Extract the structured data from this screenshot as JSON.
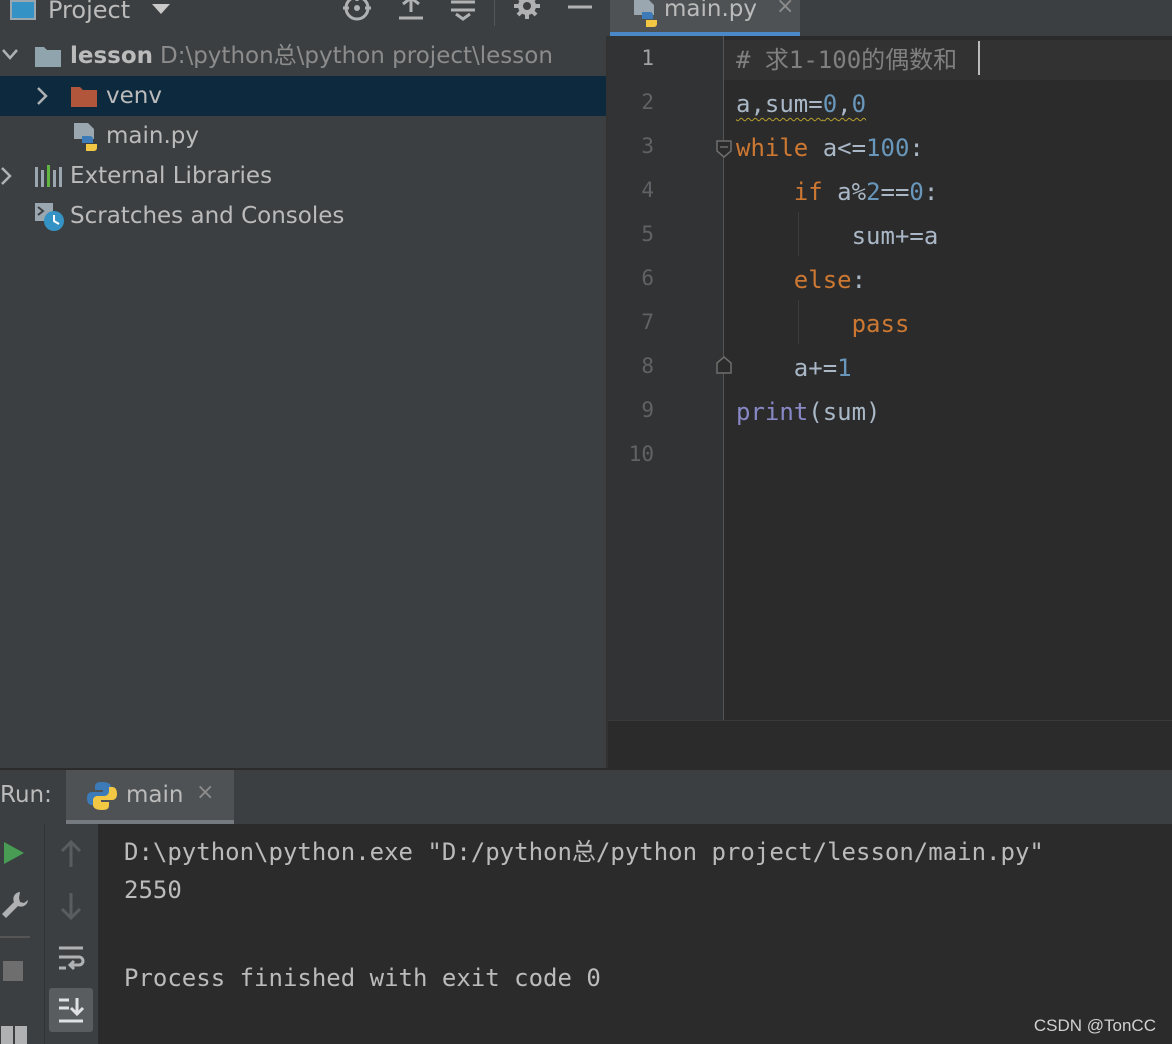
{
  "project_panel": {
    "title": "Project",
    "tree": [
      {
        "label": "lesson",
        "path": "D:\\python总\\python project\\lesson",
        "icon": "folder-icon",
        "expanded": true
      },
      {
        "label": "venv",
        "icon": "excluded-folder-icon",
        "selected": true
      },
      {
        "label": "main.py",
        "icon": "python-file-icon"
      },
      {
        "label": "External Libraries",
        "icon": "libraries-icon"
      },
      {
        "label": "Scratches and Consoles",
        "icon": "scratches-icon"
      }
    ]
  },
  "editor": {
    "tab": {
      "label": "main.py",
      "close": "×"
    },
    "line_numbers": [
      "1",
      "2",
      "3",
      "4",
      "5",
      "6",
      "7",
      "8",
      "9",
      "10"
    ],
    "lines": [
      "# 求1-100的偶数和",
      "a,sum=0,0",
      "while a<=100:",
      "    if a%2==0:",
      "        sum+=a",
      "    else:",
      "        pass",
      "    a+=1",
      "print(sum)",
      ""
    ],
    "colors": {
      "keyword": "#cc7832",
      "number": "#6897bb",
      "comment": "#808080",
      "builtin": "#8888c6",
      "text": "#a9b7c6"
    }
  },
  "run_panel": {
    "label": "Run:",
    "tab": {
      "label": "main",
      "close": "×"
    },
    "console": [
      "D:\\python\\python.exe \"D:/python总/python project/lesson/main.py\"",
      "2550",
      "",
      "Process finished with exit code 0"
    ]
  },
  "watermark": "CSDN @TonCC"
}
